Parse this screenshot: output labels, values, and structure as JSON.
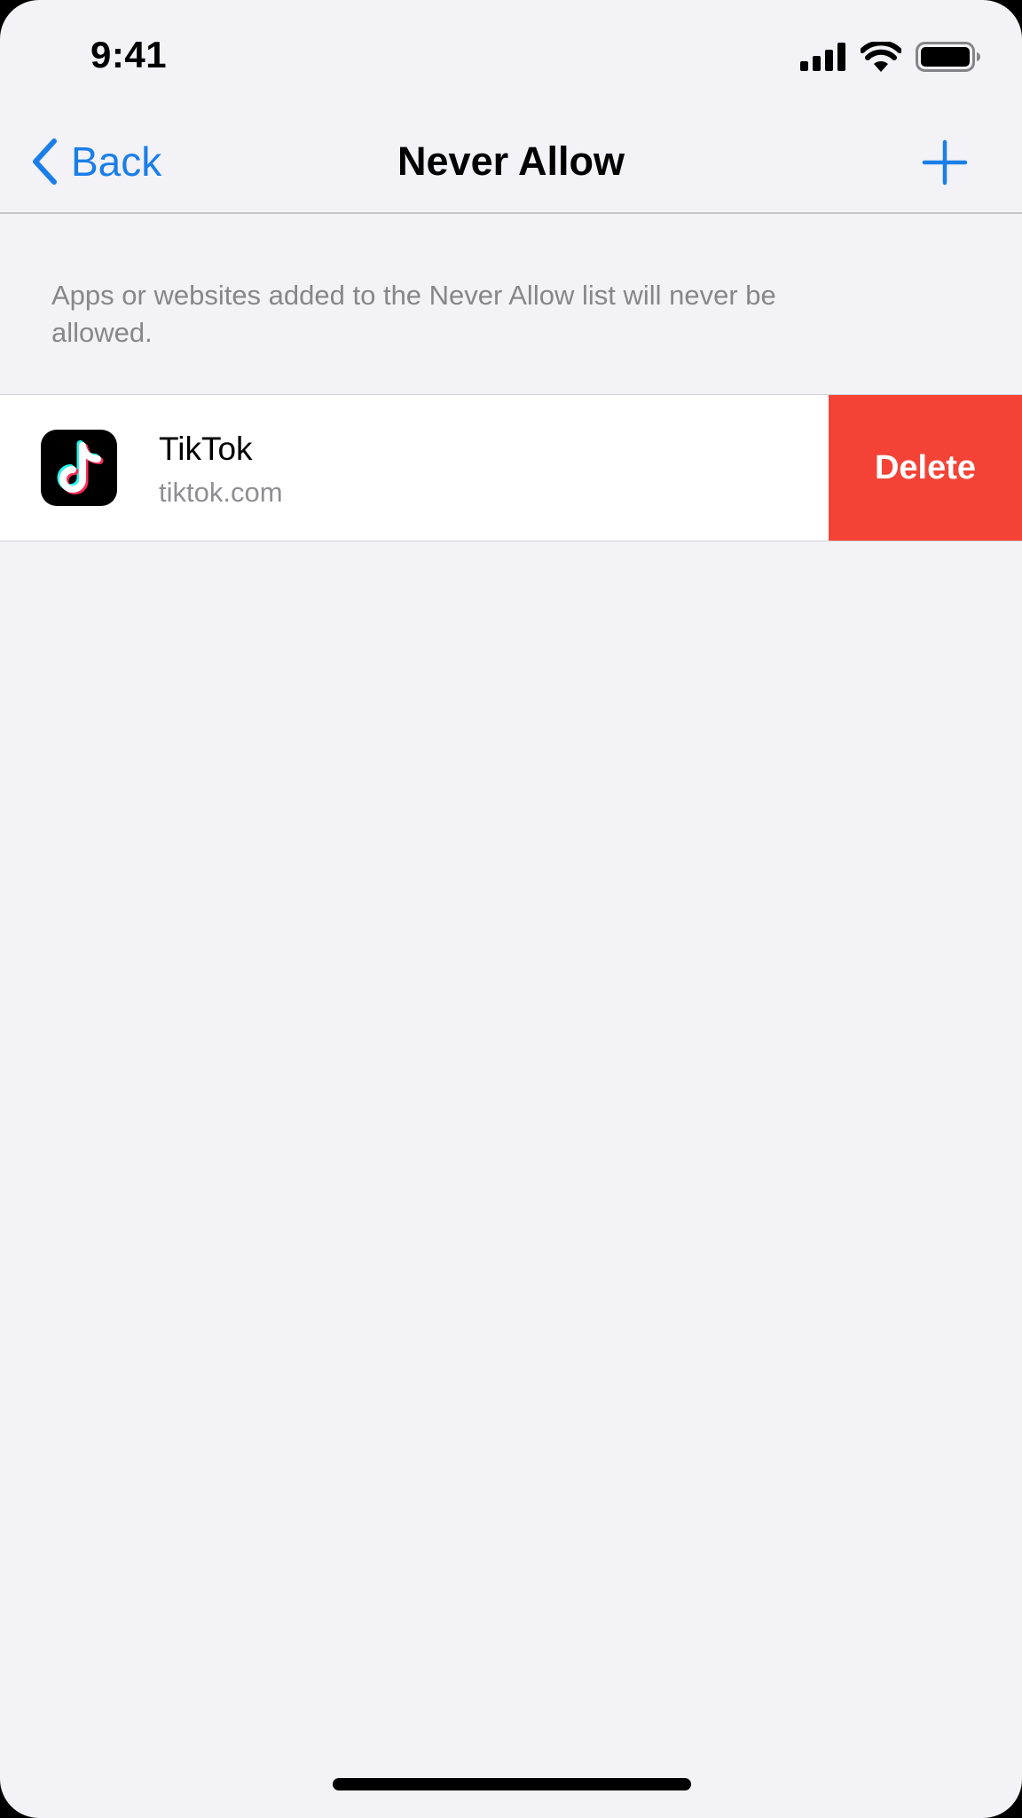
{
  "status_bar": {
    "time": "9:41"
  },
  "nav": {
    "back_label": "Back",
    "title": "Never Allow"
  },
  "description": "Apps or websites added to the Never Allow list will never be allowed.",
  "items": [
    {
      "name": "TikTok",
      "domain": "tiktok.com",
      "icon": "tiktok-app-icon",
      "action_label": "Delete"
    }
  ],
  "colors": {
    "accent": "#1a7ee8",
    "destructive": "#f44336",
    "background": "#f2f2f7",
    "secondary_text": "#8e8e93"
  }
}
